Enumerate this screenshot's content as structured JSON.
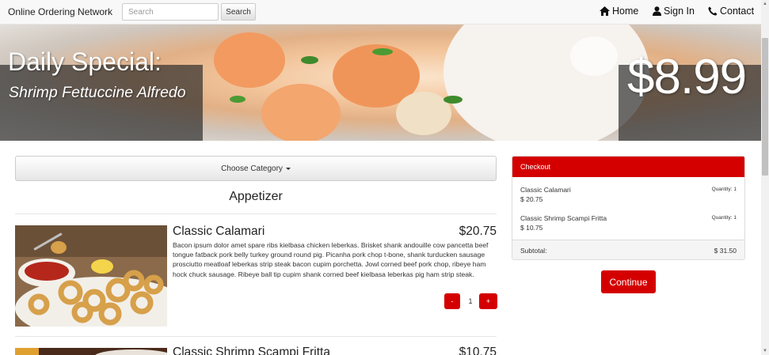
{
  "navbar": {
    "brand": "Online Ordering Network",
    "search_placeholder": "Search",
    "search_button": "Search",
    "links": [
      {
        "label": "Home",
        "icon": "home-icon"
      },
      {
        "label": "Sign In",
        "icon": "user-icon"
      },
      {
        "label": "Contact",
        "icon": "phone-icon"
      }
    ]
  },
  "hero": {
    "title": "Daily Special:",
    "dish": "Shrimp Fettuccine Alfredo",
    "price": "$8.99"
  },
  "menu": {
    "category_button": "Choose Category",
    "section": "Appetizer",
    "items": [
      {
        "name": "Classic Calamari",
        "price": "$20.75",
        "description": "Bacon ipsum dolor amet spare ribs kielbasa chicken leberkas. Brisket shank andouille cow pancetta beef tongue fatback pork belly turkey ground round pig. Picanha pork chop t-bone, shank turducken sausage prosciutto meatloaf leberkas strip steak bacon cupim porchetta. Jowl corned beef pork chop, ribeye ham hock chuck sausage. Ribeye ball tip cupim shank corned beef kielbasa leberkas pig ham strip steak.",
        "quantity": "1",
        "minus_label": "-",
        "plus_label": "+"
      },
      {
        "name": "Classic Shrimp Scampi Fritta",
        "price": "$10.75"
      }
    ]
  },
  "checkout": {
    "title": "Checkout",
    "items": [
      {
        "name": "Classic Calamari",
        "quantity": "Quantity: 1",
        "price": "$ 20.75"
      },
      {
        "name": "Classic Shrimp Scampi Fritta",
        "quantity": "Quantity: 1",
        "price": "$ 10.75"
      }
    ],
    "subtotal_label": "Subtotal:",
    "subtotal_value": "$ 31.50",
    "continue_button": "Continue"
  },
  "colors": {
    "accent": "#d40000",
    "navbar_bg": "#f8f8f8",
    "hero_overlay": "#323232"
  }
}
